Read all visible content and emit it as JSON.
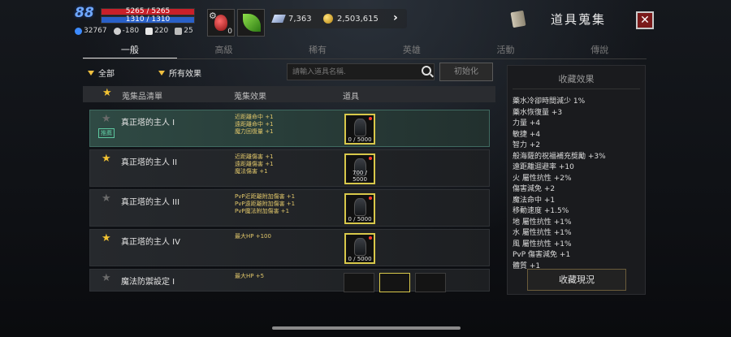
{
  "player": {
    "level": "88",
    "hp_text": "5265 / 5265",
    "mp_text": "1310 / 1310",
    "stats": [
      {
        "icon": "blue-crystal-icon",
        "value": "32767"
      },
      {
        "icon": "skull-icon",
        "value": "-180"
      },
      {
        "icon": "wing-icon",
        "value": "220"
      },
      {
        "icon": "horse-icon",
        "value": "25"
      }
    ]
  },
  "quick_slots": [
    {
      "icon": "health-potion-icon",
      "count": "0"
    },
    {
      "icon": "green-leaf-icon",
      "count": ""
    }
  ],
  "currency": {
    "gems": "7,363",
    "gold": "2,503,615"
  },
  "window": {
    "title": "道具蒐集",
    "close": "✕"
  },
  "tabs": [
    {
      "label": "一般",
      "active": true
    },
    {
      "label": "高級",
      "active": false
    },
    {
      "label": "稀有",
      "active": false
    },
    {
      "label": "英雄",
      "active": false
    },
    {
      "label": "活動",
      "active": false
    },
    {
      "label": "傳說",
      "active": false
    }
  ],
  "filters": {
    "category": "全部",
    "effect": "所有效果",
    "search_placeholder": "請輸入道具名稱.",
    "reset": "初始化"
  },
  "table": {
    "headers": {
      "list": "蒐集品清單",
      "effect": "蒐集效果",
      "item": "道具"
    },
    "rows": [
      {
        "name": "真正塔的主人 I",
        "star": "grey",
        "tag": "推薦",
        "effects": [
          "近距離命中 +1",
          "遠距離命中 +1",
          "魔力回復量 +1"
        ],
        "items": [
          {
            "count": "0 / 5000",
            "red_dot": true
          }
        ]
      },
      {
        "name": "真正塔的主人 II",
        "star": "gold",
        "tag": "",
        "effects": [
          "近距離傷害 +1",
          "遠距離傷害 +1",
          "魔法傷害 +1"
        ],
        "items": [
          {
            "count": "700 / 5000",
            "red_dot": true
          }
        ]
      },
      {
        "name": "真正塔的主人 III",
        "star": "grey",
        "tag": "",
        "effects": [
          "PvP近距離附加傷害 +1",
          "PvP遠距離附加傷害 +1",
          "PvP魔法附加傷害 +1"
        ],
        "items": [
          {
            "count": "0 / 5000",
            "red_dot": true
          }
        ]
      },
      {
        "name": "真正塔的主人 IV",
        "star": "gold",
        "tag": "",
        "effects": [
          "最大HP +100"
        ],
        "items": [
          {
            "count": "0 / 5000",
            "red_dot": true
          }
        ]
      },
      {
        "name": "魔法防禦設定 I",
        "star": "grey",
        "tag": "",
        "effects": [
          "最大HP +5"
        ],
        "items": []
      }
    ]
  },
  "collection_effects": {
    "title": "收藏效果",
    "lines": [
      "藥水冷卻時間減少 1%",
      "藥水恢復量 +3",
      "力量 +4",
      "敏捷 +4",
      "智力 +2",
      "般海薩的祝福補充獎勵 +3%",
      "遠距離迴避率 +10",
      "火 屬性抗性 +2%",
      "傷害減免 +2",
      "魔法命中 +1",
      "移動速度 +1.5%",
      "地 屬性抗性 +1%",
      "水 屬性抗性 +1%",
      "風 屬性抗性 +1%",
      "PvP 傷害減免 +1",
      "體質 +1"
    ],
    "button": "收藏現況"
  }
}
